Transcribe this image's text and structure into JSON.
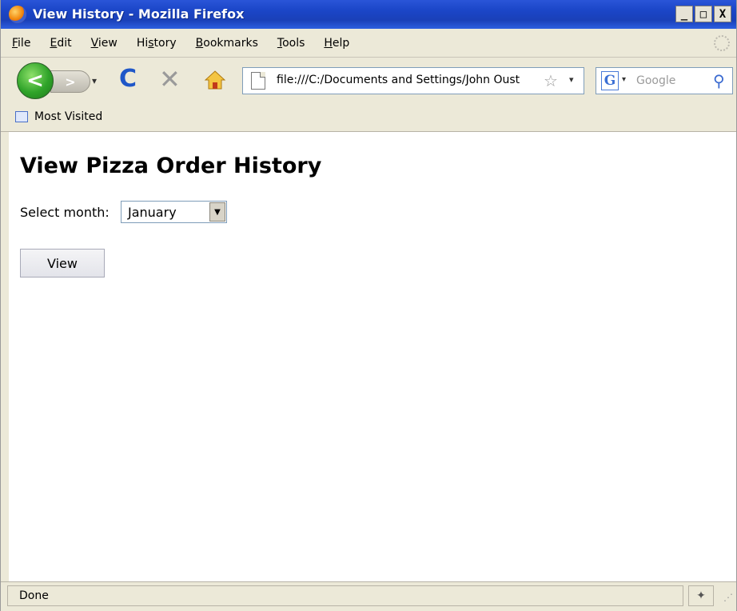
{
  "window": {
    "title": "View History - Mozilla Firefox",
    "controls": {
      "minimize": "_",
      "maximize": "□",
      "close": "X"
    }
  },
  "menu": {
    "items": [
      {
        "accel": "F",
        "rest": "ile"
      },
      {
        "accel": "E",
        "rest": "dit"
      },
      {
        "accel": "V",
        "rest": "iew"
      },
      {
        "accel": "",
        "rest": "Hi",
        "accel2": "s",
        "rest2": "tory"
      },
      {
        "accel": "B",
        "rest": "ookmarks"
      },
      {
        "accel": "T",
        "rest": "ools"
      },
      {
        "accel": "H",
        "rest": "elp"
      }
    ]
  },
  "nav": {
    "back_glyph": "<",
    "forward_glyph": ">",
    "history_dropdown_glyph": "▾",
    "reload_glyph": "C",
    "stop_glyph": "✕",
    "url": "file:///C:/Documents and Settings/John Oust",
    "star_glyph": "☆",
    "url_dropdown_glyph": "▾"
  },
  "search": {
    "engine_glyph": "G",
    "engine_dropdown_glyph": "▾",
    "placeholder": "Google",
    "search_glyph": "⚲"
  },
  "bookmarks": {
    "most_visited": "Most Visited"
  },
  "page": {
    "title": "View Pizza Order History",
    "select_label": "Select month:",
    "selected_month": "January",
    "select_arrow": "▼",
    "view_button": "View"
  },
  "status": {
    "text": "Done",
    "icon_glyph": "✦",
    "grip_glyph": "⋰"
  },
  "colors": {
    "titlebar": "#1b46c8",
    "chrome": "#ece9d8",
    "content_bg": "#ffffff"
  }
}
